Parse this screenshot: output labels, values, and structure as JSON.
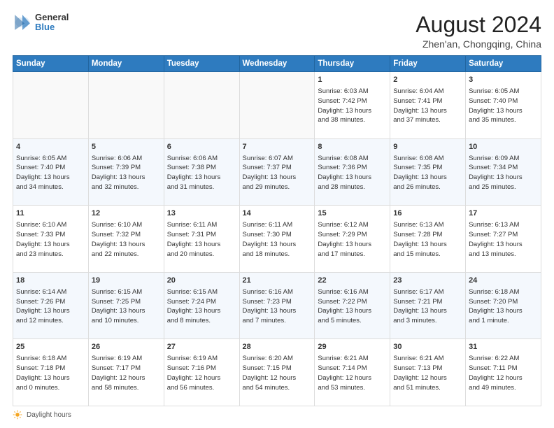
{
  "header": {
    "logo_line1": "General",
    "logo_line2": "Blue",
    "month_year": "August 2024",
    "location": "Zhen'an, Chongqing, China"
  },
  "days_of_week": [
    "Sunday",
    "Monday",
    "Tuesday",
    "Wednesday",
    "Thursday",
    "Friday",
    "Saturday"
  ],
  "weeks": [
    [
      {
        "day": "",
        "info": ""
      },
      {
        "day": "",
        "info": ""
      },
      {
        "day": "",
        "info": ""
      },
      {
        "day": "",
        "info": ""
      },
      {
        "day": "1",
        "info": "Sunrise: 6:03 AM\nSunset: 7:42 PM\nDaylight: 13 hours\nand 38 minutes."
      },
      {
        "day": "2",
        "info": "Sunrise: 6:04 AM\nSunset: 7:41 PM\nDaylight: 13 hours\nand 37 minutes."
      },
      {
        "day": "3",
        "info": "Sunrise: 6:05 AM\nSunset: 7:40 PM\nDaylight: 13 hours\nand 35 minutes."
      }
    ],
    [
      {
        "day": "4",
        "info": "Sunrise: 6:05 AM\nSunset: 7:40 PM\nDaylight: 13 hours\nand 34 minutes."
      },
      {
        "day": "5",
        "info": "Sunrise: 6:06 AM\nSunset: 7:39 PM\nDaylight: 13 hours\nand 32 minutes."
      },
      {
        "day": "6",
        "info": "Sunrise: 6:06 AM\nSunset: 7:38 PM\nDaylight: 13 hours\nand 31 minutes."
      },
      {
        "day": "7",
        "info": "Sunrise: 6:07 AM\nSunset: 7:37 PM\nDaylight: 13 hours\nand 29 minutes."
      },
      {
        "day": "8",
        "info": "Sunrise: 6:08 AM\nSunset: 7:36 PM\nDaylight: 13 hours\nand 28 minutes."
      },
      {
        "day": "9",
        "info": "Sunrise: 6:08 AM\nSunset: 7:35 PM\nDaylight: 13 hours\nand 26 minutes."
      },
      {
        "day": "10",
        "info": "Sunrise: 6:09 AM\nSunset: 7:34 PM\nDaylight: 13 hours\nand 25 minutes."
      }
    ],
    [
      {
        "day": "11",
        "info": "Sunrise: 6:10 AM\nSunset: 7:33 PM\nDaylight: 13 hours\nand 23 minutes."
      },
      {
        "day": "12",
        "info": "Sunrise: 6:10 AM\nSunset: 7:32 PM\nDaylight: 13 hours\nand 22 minutes."
      },
      {
        "day": "13",
        "info": "Sunrise: 6:11 AM\nSunset: 7:31 PM\nDaylight: 13 hours\nand 20 minutes."
      },
      {
        "day": "14",
        "info": "Sunrise: 6:11 AM\nSunset: 7:30 PM\nDaylight: 13 hours\nand 18 minutes."
      },
      {
        "day": "15",
        "info": "Sunrise: 6:12 AM\nSunset: 7:29 PM\nDaylight: 13 hours\nand 17 minutes."
      },
      {
        "day": "16",
        "info": "Sunrise: 6:13 AM\nSunset: 7:28 PM\nDaylight: 13 hours\nand 15 minutes."
      },
      {
        "day": "17",
        "info": "Sunrise: 6:13 AM\nSunset: 7:27 PM\nDaylight: 13 hours\nand 13 minutes."
      }
    ],
    [
      {
        "day": "18",
        "info": "Sunrise: 6:14 AM\nSunset: 7:26 PM\nDaylight: 13 hours\nand 12 minutes."
      },
      {
        "day": "19",
        "info": "Sunrise: 6:15 AM\nSunset: 7:25 PM\nDaylight: 13 hours\nand 10 minutes."
      },
      {
        "day": "20",
        "info": "Sunrise: 6:15 AM\nSunset: 7:24 PM\nDaylight: 13 hours\nand 8 minutes."
      },
      {
        "day": "21",
        "info": "Sunrise: 6:16 AM\nSunset: 7:23 PM\nDaylight: 13 hours\nand 7 minutes."
      },
      {
        "day": "22",
        "info": "Sunrise: 6:16 AM\nSunset: 7:22 PM\nDaylight: 13 hours\nand 5 minutes."
      },
      {
        "day": "23",
        "info": "Sunrise: 6:17 AM\nSunset: 7:21 PM\nDaylight: 13 hours\nand 3 minutes."
      },
      {
        "day": "24",
        "info": "Sunrise: 6:18 AM\nSunset: 7:20 PM\nDaylight: 13 hours\nand 1 minute."
      }
    ],
    [
      {
        "day": "25",
        "info": "Sunrise: 6:18 AM\nSunset: 7:18 PM\nDaylight: 13 hours\nand 0 minutes."
      },
      {
        "day": "26",
        "info": "Sunrise: 6:19 AM\nSunset: 7:17 PM\nDaylight: 12 hours\nand 58 minutes."
      },
      {
        "day": "27",
        "info": "Sunrise: 6:19 AM\nSunset: 7:16 PM\nDaylight: 12 hours\nand 56 minutes."
      },
      {
        "day": "28",
        "info": "Sunrise: 6:20 AM\nSunset: 7:15 PM\nDaylight: 12 hours\nand 54 minutes."
      },
      {
        "day": "29",
        "info": "Sunrise: 6:21 AM\nSunset: 7:14 PM\nDaylight: 12 hours\nand 53 minutes."
      },
      {
        "day": "30",
        "info": "Sunrise: 6:21 AM\nSunset: 7:13 PM\nDaylight: 12 hours\nand 51 minutes."
      },
      {
        "day": "31",
        "info": "Sunrise: 6:22 AM\nSunset: 7:11 PM\nDaylight: 12 hours\nand 49 minutes."
      }
    ]
  ],
  "footer": {
    "daylight_label": "Daylight hours"
  }
}
